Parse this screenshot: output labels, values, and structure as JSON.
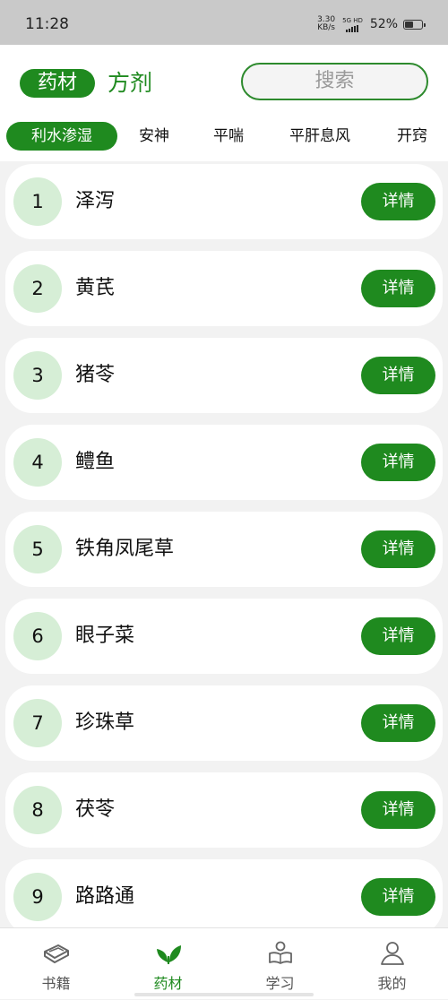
{
  "status_bar": {
    "time": "11:28",
    "net_speed_value": "3.30",
    "net_speed_unit": "KB/s",
    "net_type": "5G HD",
    "battery_percent": "52%",
    "battery_level": 0.52
  },
  "header": {
    "category_tabs": [
      {
        "label": "药材",
        "active": true
      },
      {
        "label": "方剂",
        "active": false
      }
    ],
    "search_label": "搜索",
    "sub_tabs": [
      {
        "label": "利水渗湿",
        "active": true
      },
      {
        "label": "安神",
        "active": false
      },
      {
        "label": "平喘",
        "active": false
      },
      {
        "label": "平肝息风",
        "active": false
      },
      {
        "label": "开窍",
        "active": false
      }
    ]
  },
  "list": {
    "detail_label": "详情",
    "items": [
      {
        "number": "1",
        "name": "泽泻"
      },
      {
        "number": "2",
        "name": "黄芪"
      },
      {
        "number": "3",
        "name": "猪苓"
      },
      {
        "number": "4",
        "name": "鳢鱼"
      },
      {
        "number": "5",
        "name": "铁角凤尾草"
      },
      {
        "number": "6",
        "name": "眼子菜"
      },
      {
        "number": "7",
        "name": "珍珠草"
      },
      {
        "number": "8",
        "name": "茯苓"
      },
      {
        "number": "9",
        "name": "路路通"
      }
    ]
  },
  "bottom_nav": {
    "items": [
      {
        "label": "书籍",
        "icon": "book-icon",
        "active": false
      },
      {
        "label": "药材",
        "icon": "leaf-icon",
        "active": true
      },
      {
        "label": "学习",
        "icon": "reading-person-icon",
        "active": false
      },
      {
        "label": "我的",
        "icon": "profile-icon",
        "active": false
      }
    ]
  },
  "colors": {
    "accent": "#1f8a1f",
    "number_circle": "#d6eed6",
    "background": "#f2f2f2"
  }
}
